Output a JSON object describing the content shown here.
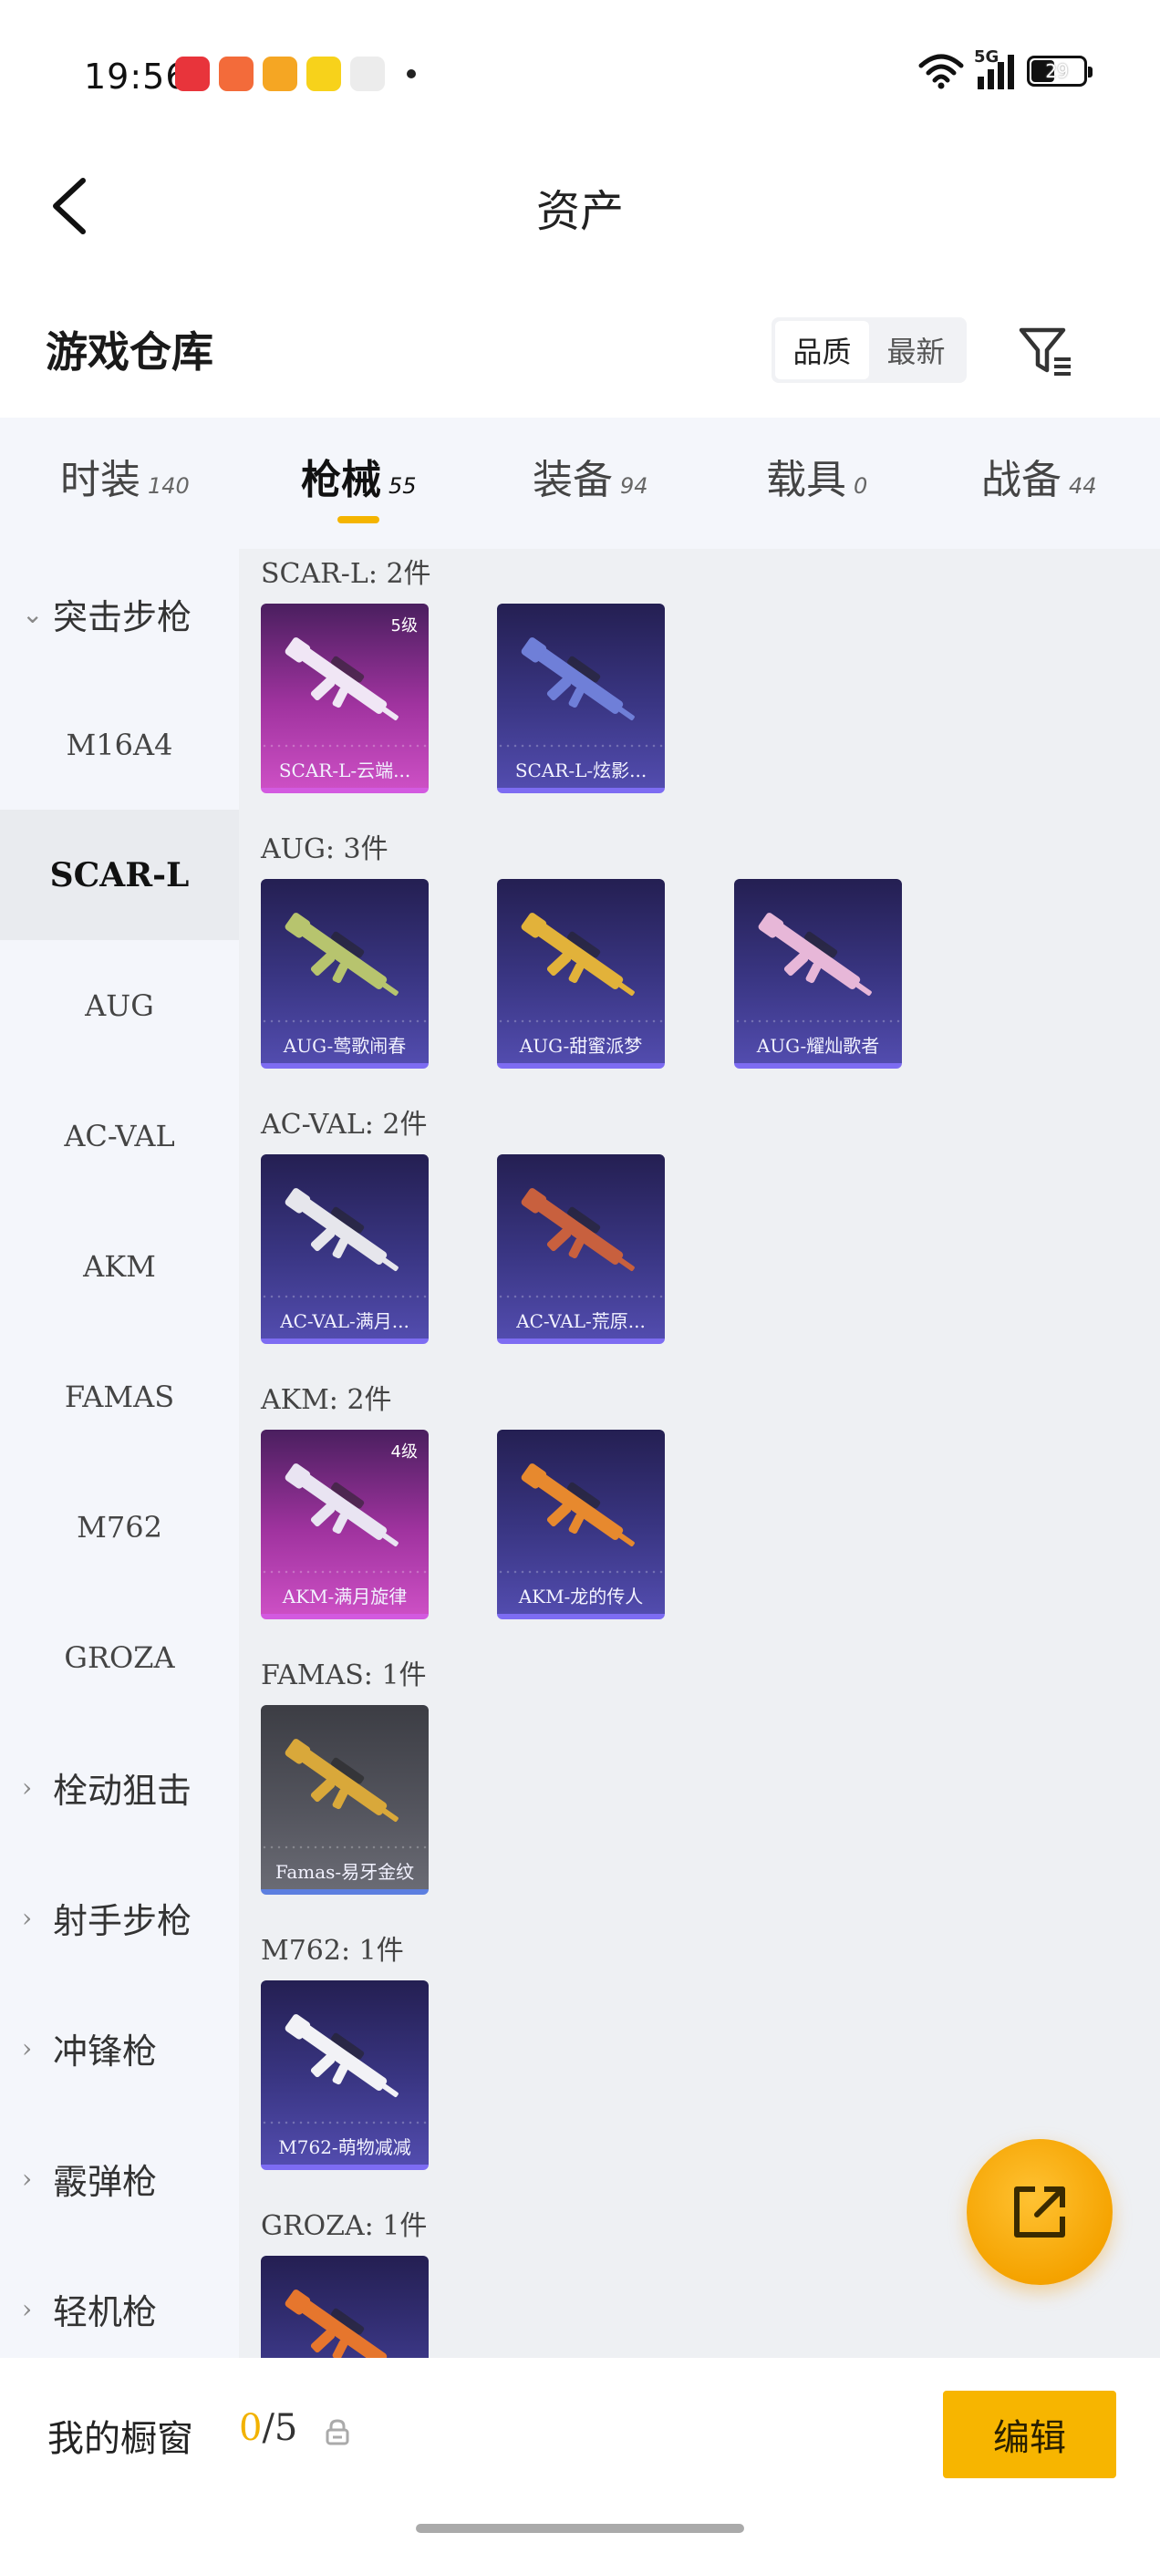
{
  "status_bar": {
    "time": "19:56",
    "network": "5G",
    "battery": "29",
    "app_icons": [
      {
        "name": "music-app-icon",
        "color": "#e8343b"
      },
      {
        "name": "game-app-icon",
        "color": "#f36b3a"
      },
      {
        "name": "video-app-icon",
        "color": "#f5a623"
      },
      {
        "name": "comic-app-icon",
        "color": "#f7d21b"
      },
      {
        "name": "flower-app-icon",
        "color": "#e7e7e7"
      }
    ]
  },
  "header": {
    "title": "资产"
  },
  "warehouse": {
    "title": "游戏仓库",
    "sort_options": [
      "品质",
      "最新"
    ],
    "active_sort": 0
  },
  "tabs": [
    {
      "label": "时装",
      "count": "140"
    },
    {
      "label": "枪械",
      "count": "55",
      "active": true
    },
    {
      "label": "装备",
      "count": "94"
    },
    {
      "label": "载具",
      "count": "0"
    },
    {
      "label": "战备",
      "count": "44"
    }
  ],
  "sidebar": {
    "items": [
      {
        "label": "突击步枪",
        "type": "group",
        "expanded": true
      },
      {
        "label": "M16A4",
        "type": "sub"
      },
      {
        "label": "SCAR-L",
        "type": "sub",
        "active": true
      },
      {
        "label": "AUG",
        "type": "sub"
      },
      {
        "label": "AC-VAL",
        "type": "sub"
      },
      {
        "label": "AKM",
        "type": "sub"
      },
      {
        "label": "FAMAS",
        "type": "sub"
      },
      {
        "label": "M762",
        "type": "sub"
      },
      {
        "label": "GROZA",
        "type": "sub"
      },
      {
        "label": "栓动狙击",
        "type": "group"
      },
      {
        "label": "射手步枪",
        "type": "group"
      },
      {
        "label": "冲锋枪",
        "type": "group"
      },
      {
        "label": "霰弹枪",
        "type": "group"
      },
      {
        "label": "轻机枪",
        "type": "group"
      }
    ]
  },
  "sections": [
    {
      "label": "SCAR-L: 2件",
      "items": [
        {
          "name": "SCAR-L-云端...",
          "rarity": "pink",
          "level": "5级",
          "color": "#f0e6f5"
        },
        {
          "name": "SCAR-L-炫影...",
          "rarity": "purple",
          "color": "#6f7fd8"
        }
      ]
    },
    {
      "label": "AUG: 3件",
      "items": [
        {
          "name": "AUG-莺歌闹春",
          "rarity": "purple",
          "color": "#b7c46e"
        },
        {
          "name": "AUG-甜蜜派梦",
          "rarity": "purple",
          "color": "#e2b23a"
        },
        {
          "name": "AUG-耀灿歌者",
          "rarity": "purple",
          "color": "#e7b7d8"
        }
      ]
    },
    {
      "label": "AC-VAL: 2件",
      "items": [
        {
          "name": "AC-VAL-满月...",
          "rarity": "purple",
          "color": "#e6e6ec"
        },
        {
          "name": "AC-VAL-荒原...",
          "rarity": "purple",
          "color": "#c8603e"
        }
      ]
    },
    {
      "label": "AKM: 2件",
      "items": [
        {
          "name": "AKM-满月旋律",
          "rarity": "pink",
          "level": "4级",
          "color": "#e9e4f2"
        },
        {
          "name": "AKM-龙的传人",
          "rarity": "purple",
          "color": "#e7892e"
        }
      ]
    },
    {
      "label": "FAMAS: 1件",
      "items": [
        {
          "name": "Famas-易牙金纹",
          "rarity": "gray",
          "color": "#d9a83a"
        }
      ]
    },
    {
      "label": "M762: 1件",
      "items": [
        {
          "name": "M762-萌物减减",
          "rarity": "purple",
          "color": "#f2f2f6"
        }
      ]
    },
    {
      "label": "GROZA: 1件",
      "items": [
        {
          "name": "",
          "rarity": "purple",
          "color": "#e6762d"
        }
      ]
    }
  ],
  "footer": {
    "showcase_label": "我的橱窗",
    "showcase_current": "0",
    "showcase_total": "/5",
    "edit_label": "编辑"
  }
}
